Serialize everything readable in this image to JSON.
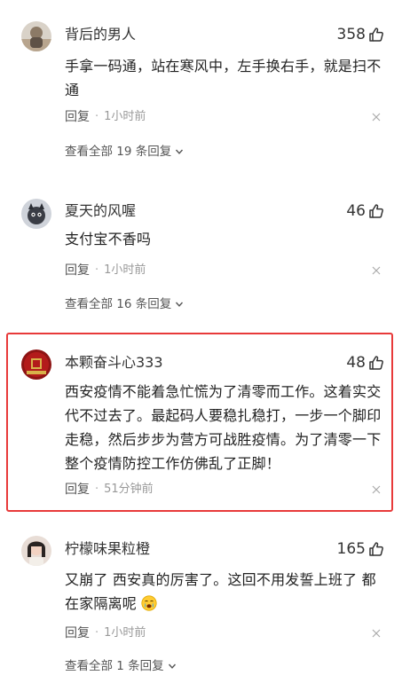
{
  "colors": {
    "highlight_border": "#e83a3a",
    "text_primary": "#222222",
    "text_secondary": "#888888"
  },
  "comments": [
    {
      "username": "背后的男人",
      "likes": "358",
      "text": "手拿一码通，站在寒风中，左手换右手，就是扫不通",
      "reply_label": "回复",
      "time": "1小时前",
      "view_all": "查看全部 19 条回复"
    },
    {
      "username": "夏天的风喔",
      "likes": "46",
      "text": "支付宝不香吗",
      "reply_label": "回复",
      "time": "1小时前",
      "view_all": "查看全部 16 条回复"
    },
    {
      "username": "本颗奋斗心333",
      "likes": "48",
      "text": "西安疫情不能着急忙慌为了清零而工作。这着实交代不过去了。最起码人要稳扎稳打，一步一个脚印走稳，然后步步为营方可战胜疫情。为了清零一下整个疫情防控工作仿佛乱了正脚！",
      "reply_label": "回复",
      "time": "51分钟前",
      "highlighted": true
    },
    {
      "username": "柠檬味果粒橙",
      "likes": "165",
      "text": "又崩了 西安真的厉害了。这回不用发誓上班了 都在家隔离呢",
      "emoji": "crying-face-icon",
      "reply_label": "回复",
      "time": "1小时前",
      "view_all": "查看全部 1 条回复"
    }
  ]
}
